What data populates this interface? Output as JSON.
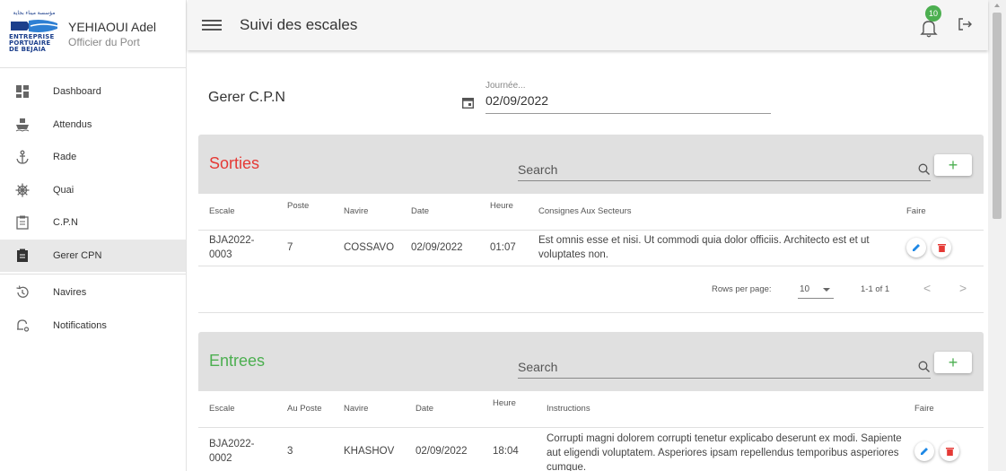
{
  "user": {
    "name": "YEHIAOUI Adel",
    "role": "Officier du Port"
  },
  "logo": {
    "arabic": "مؤسسة ميناء بجاية",
    "lines": [
      "ENTREPRISE",
      "PORTUAIRE",
      "DE BEJAIA"
    ]
  },
  "sidebar": {
    "items": [
      {
        "label": "Dashboard",
        "icon": "dashboard-icon"
      },
      {
        "label": "Attendus",
        "icon": "ship-icon"
      },
      {
        "label": "Rade",
        "icon": "anchor-icon"
      },
      {
        "label": "Quai",
        "icon": "helm-icon"
      },
      {
        "label": "C.P.N",
        "icon": "clipboard-icon"
      },
      {
        "label": "Gerer CPN",
        "icon": "clipboard-check-icon",
        "active": true
      },
      {
        "label": "Navires",
        "icon": "history-icon"
      },
      {
        "label": "Notifications",
        "icon": "bell-settings-icon"
      }
    ]
  },
  "topbar": {
    "title": "Suivi des escales",
    "notification_count": "10"
  },
  "page": {
    "title": "Gerer C.P.N",
    "date_label": "Journée...",
    "date_value": "02/09/2022"
  },
  "sorties": {
    "title": "Sorties",
    "search_placeholder": "Search",
    "add_label": "+",
    "columns": [
      "Escale",
      "Poste",
      "Navire",
      "Date",
      "Heure",
      "Consignes Aux Secteurs",
      "Faire"
    ],
    "rows": [
      {
        "escale": "BJA2022-0003",
        "poste": "7",
        "navire": "COSSAVO",
        "date": "02/09/2022",
        "heure": "01:07",
        "consignes": "Est omnis esse et nisi. Ut commodi quia dolor officiis. Architecto est et ut voluptates non."
      }
    ],
    "pager": {
      "rows_per_page_label": "Rows per page:",
      "rows_per_page": "10",
      "range": "1-1 of 1",
      "prev": "<",
      "next": ">"
    }
  },
  "entrees": {
    "title": "Entrees",
    "search_placeholder": "Search",
    "add_label": "+",
    "columns": [
      "Escale",
      "Au Poste",
      "Navire",
      "Date",
      "Heure",
      "Instructions",
      "Faire"
    ],
    "rows": [
      {
        "escale": "BJA2022-0002",
        "poste": "3",
        "navire": "KHASHOV",
        "date": "02/09/2022",
        "heure": "18:04",
        "instructions": "Corrupti magni dolorem corrupti tenetur explicabo deserunt ex modi. Sapiente aut eligendi voluptatem. Asperiores ipsam repellendus temporibus asperiores cumque."
      }
    ]
  },
  "colors": {
    "sorties_title": "#e53935",
    "entrees_title": "#4caf50",
    "badge": "#4caf50",
    "edit": "#1e88e5",
    "delete": "#e53935"
  }
}
